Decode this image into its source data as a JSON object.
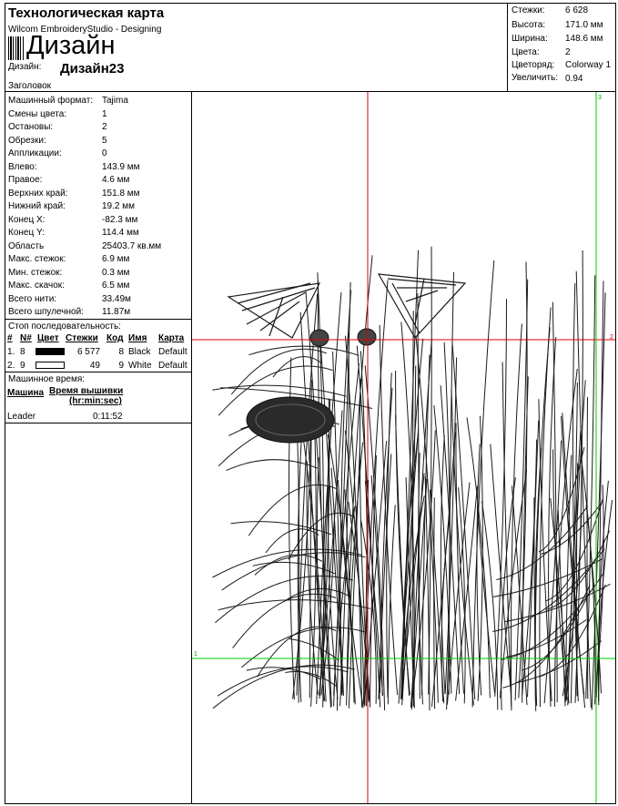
{
  "header": {
    "title": "Технологическая карта",
    "subtitle": "Wilcom EmbroideryStudio - Designing",
    "big_label": "Дизайн",
    "design_label": "Дизайн:",
    "design_name": "Дизайн23",
    "heading_label": "Заголовок"
  },
  "summary": [
    {
      "label": "Стежки:",
      "value": "6 628"
    },
    {
      "label": "Высота:",
      "value": "171.0 мм"
    },
    {
      "label": "Ширина:",
      "value": "148.6 мм"
    },
    {
      "label": "Цвета:",
      "value": "2"
    },
    {
      "label": "Цветоряд:",
      "value": "Colorway 1"
    },
    {
      "label": "Увеличить:",
      "value": "0.94"
    }
  ],
  "details": [
    {
      "label": "Машинный формат:",
      "value": "Tajima"
    },
    {
      "label": "Смены цвета:",
      "value": "1"
    },
    {
      "label": "Остановы:",
      "value": "2"
    },
    {
      "label": "Обрезки:",
      "value": "5"
    },
    {
      "label": "Аппликации:",
      "value": "0"
    },
    {
      "label": "Влево:",
      "value": "143.9 мм"
    },
    {
      "label": "Правое:",
      "value": "4.6 мм"
    },
    {
      "label": "Верхних край:",
      "value": "151.8 мм"
    },
    {
      "label": "Нижний край:",
      "value": "19.2 мм"
    },
    {
      "label": "Конец X:",
      "value": "-82.3 мм"
    },
    {
      "label": "Конец Y:",
      "value": "114.4 мм"
    },
    {
      "label": "Область",
      "value": "25403.7 кв.мм"
    },
    {
      "label": "Макс. стежок:",
      "value": "6.9 мм"
    },
    {
      "label": "Мин. стежок:",
      "value": "0.3 мм"
    },
    {
      "label": "Макс. скачок:",
      "value": "6.5 мм"
    },
    {
      "label": "Всего нити:",
      "value": "33.49м"
    },
    {
      "label": "Всего шпулечной:",
      "value": "11.87м"
    }
  ],
  "stop_sequence": {
    "title": "Стоп последовательность:",
    "headers": {
      "num": "#",
      "n": "N#",
      "color": "Цвет",
      "stitches": "Стежки",
      "code": "Код",
      "name": "Имя",
      "chart": "Карта"
    },
    "rows": [
      {
        "num": "1.",
        "n": "8",
        "swatch": "#000000",
        "stitches": "6 577",
        "code": "8",
        "name": "Black",
        "chart": "Default"
      },
      {
        "num": "2.",
        "n": "9",
        "swatch": "#ffffff",
        "stitches": "49",
        "code": "9",
        "name": "White",
        "chart": "Default"
      }
    ]
  },
  "machine_time": {
    "title": "Машинное время:",
    "col_machine": "Машина",
    "col_time": "Время вышивки",
    "col_time_unit": "(hr:min:sec)",
    "rows": [
      {
        "machine": "Leader",
        "time": "0:11:52"
      }
    ]
  },
  "preview": {
    "guide_labels": {
      "top": "3",
      "right": "2",
      "left": "1"
    },
    "colors": {
      "red_guide": "#e00000",
      "green_guide": "#00cc00",
      "thread": "#1a1a1a"
    }
  }
}
